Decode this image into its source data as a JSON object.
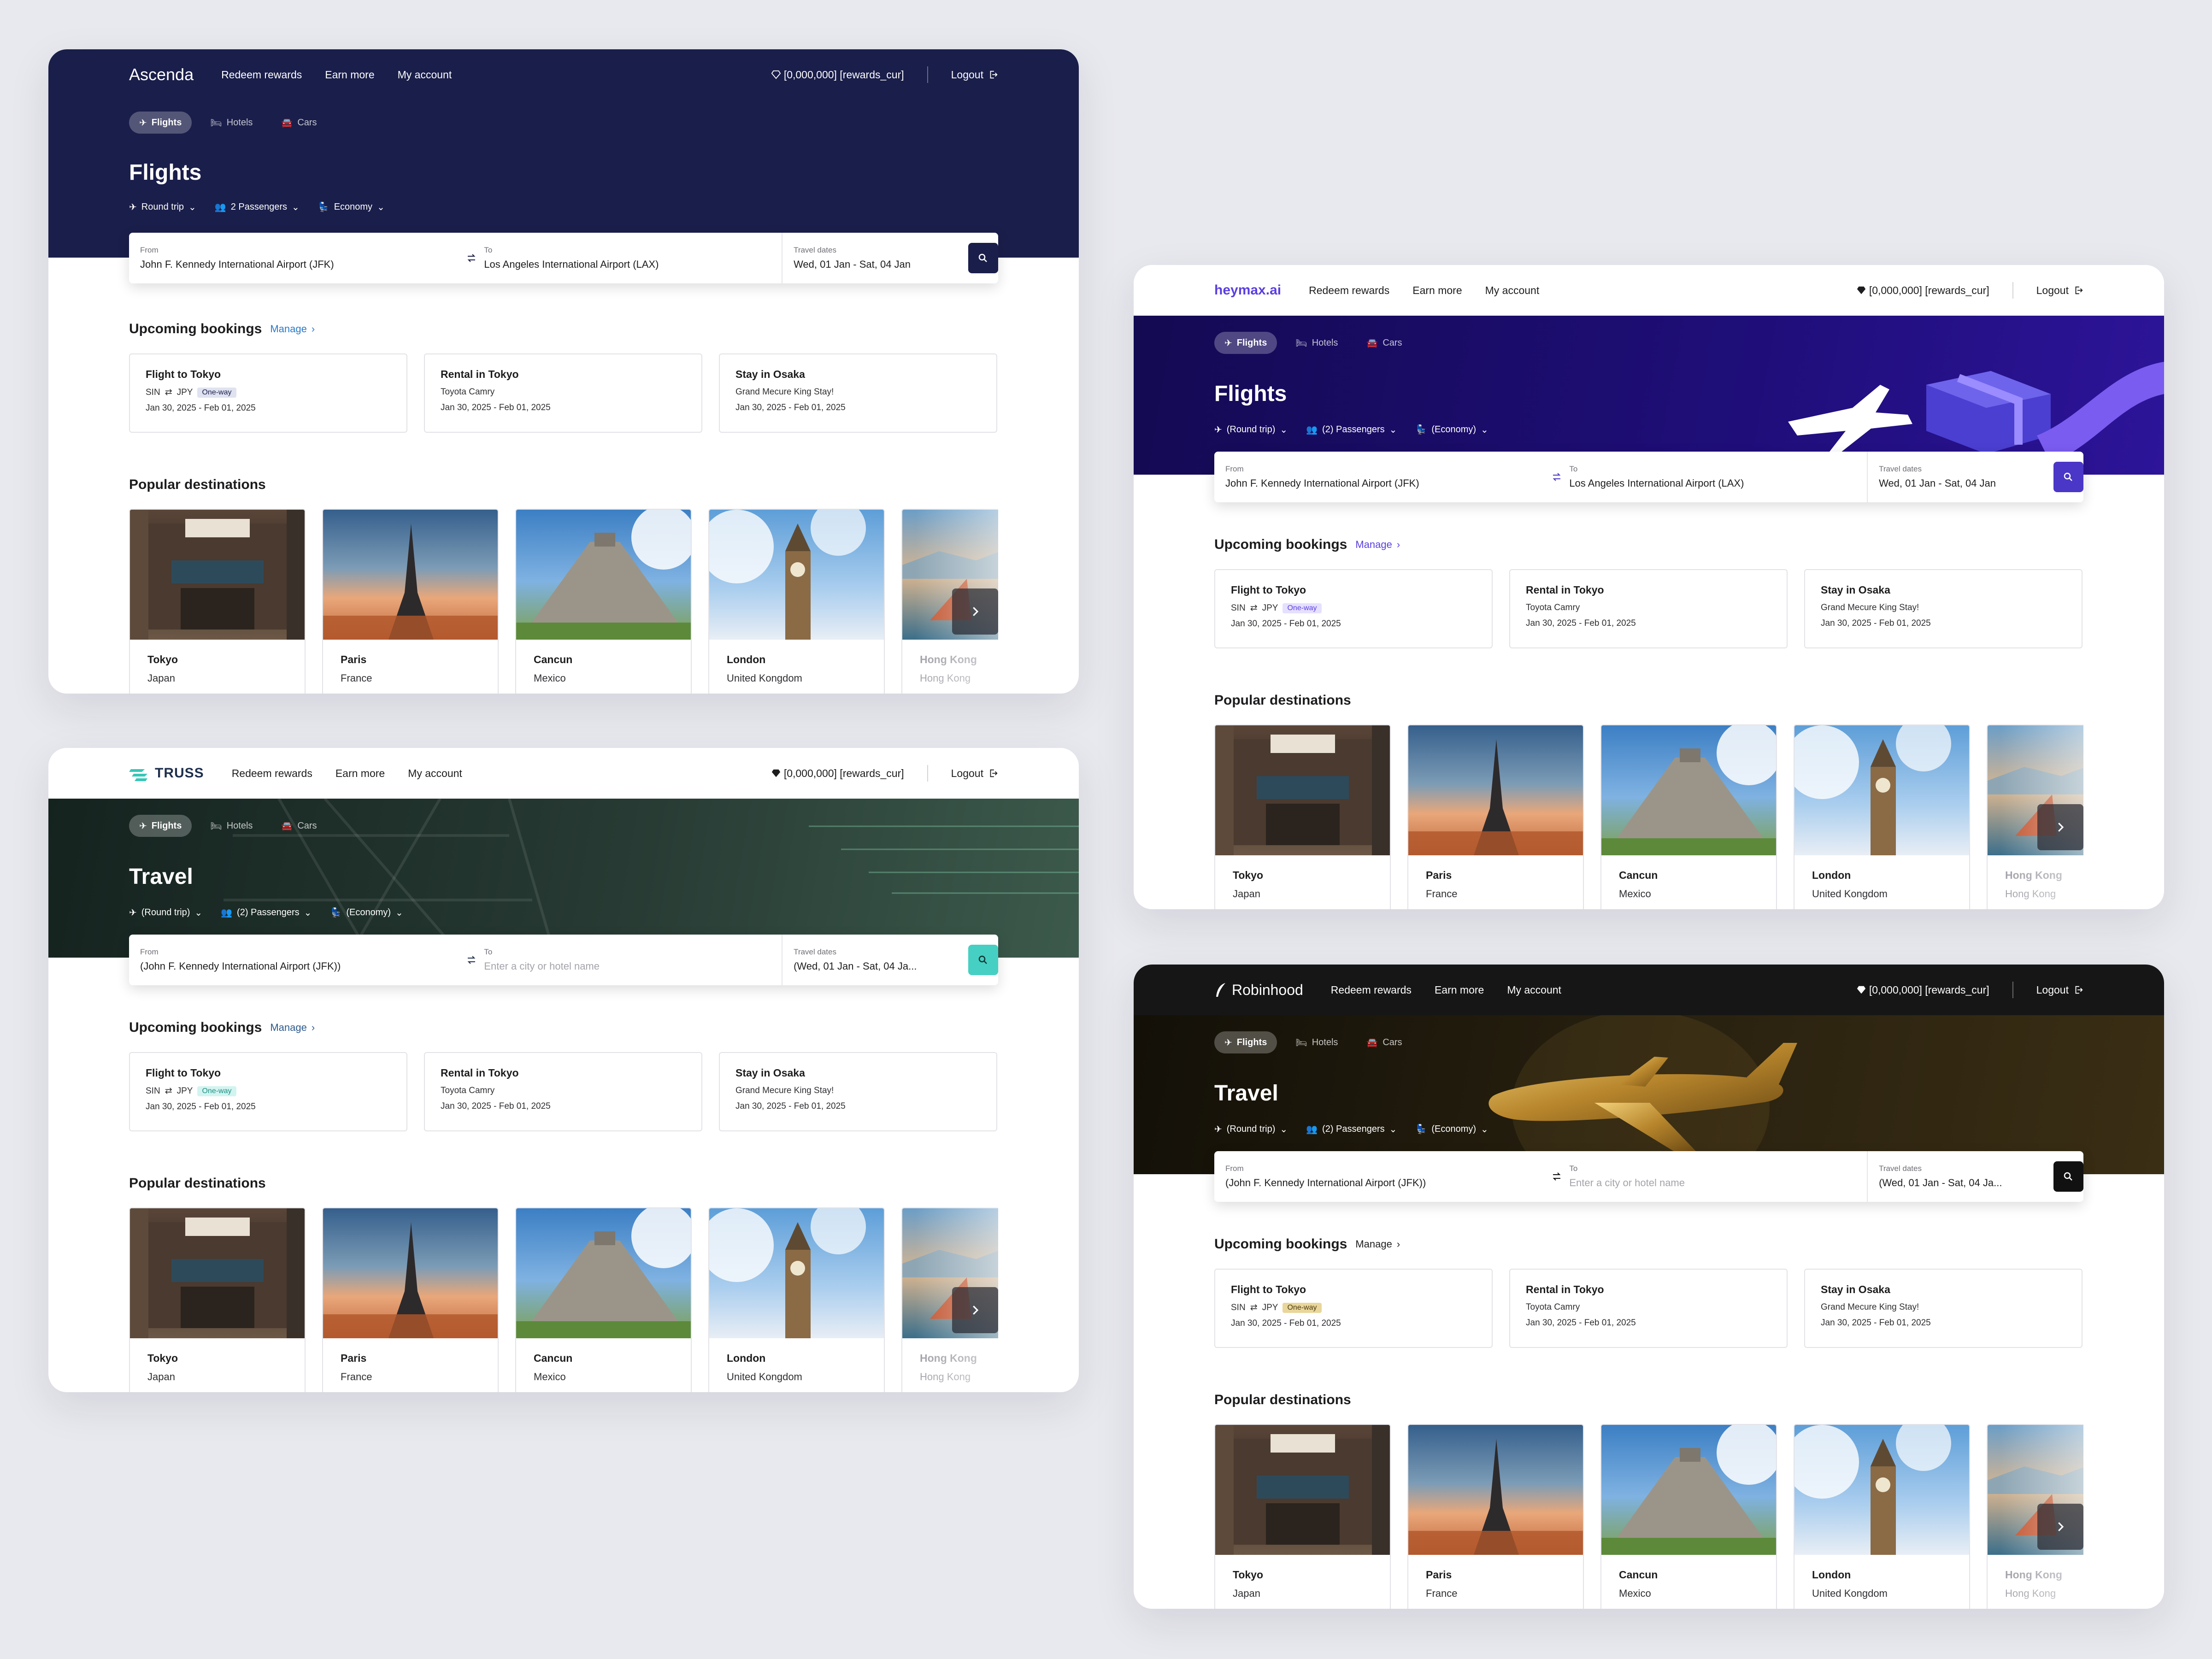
{
  "common": {
    "nav": {
      "redeem": "Redeem rewards",
      "earn": "Earn more",
      "account": "My account",
      "rewards": "[0,000,000] [rewards_cur]",
      "logout": "Logout"
    },
    "tabs": {
      "flights": "Flights",
      "hotels": "Hotels",
      "cars": "Cars"
    },
    "search": {
      "from_label": "From",
      "to_label": "To",
      "dates_label": "Travel dates",
      "from_value": "John F. Kennedy International Airport (JFK)",
      "to_value": "Los Angeles International Airport (LAX)",
      "to_placeholder": "Enter a city or hotel name",
      "dates_value": "Wed, 01 Jan - Sat, 04 Jan",
      "from_value_paren": "(John F. Kennedy International Airport (JFK))",
      "dates_value_paren": "(Wed, 01 Jan - Sat, 04 Ja..."
    },
    "options": {
      "round_trip": "Round trip",
      "passengers": "2 Passengers",
      "economy": "Economy",
      "round_trip_paren": "(Round trip)",
      "passengers_paren": "(2) Passengers",
      "economy_paren": "(Economy)"
    },
    "upcoming_title": "Upcoming bookings",
    "manage": "Manage",
    "bookings": {
      "flight": {
        "title": "Flight to Tokyo",
        "from": "SIN",
        "to": "JPY",
        "badge": "One-way",
        "dates": "Jan 30, 2025 - Feb 01, 2025"
      },
      "rental": {
        "title": "Rental in Tokyo",
        "car": "Toyota Camry",
        "dates": "Jan 30, 2025 - Feb 01, 2025"
      },
      "stay": {
        "title": "Stay in Osaka",
        "hotel": "Grand Mecure King Stay!",
        "dates": "Jan 30, 2025 - Feb 01, 2025"
      }
    },
    "popular_title": "Popular destinations",
    "destinations": [
      {
        "city": "Tokyo",
        "country": "Japan"
      },
      {
        "city": "Paris",
        "country": "France"
      },
      {
        "city": "Cancun",
        "country": "Mexico"
      },
      {
        "city": "London",
        "country": "United Kongdom"
      },
      {
        "city": "Hong Kong",
        "country": "Hong Kong"
      }
    ]
  },
  "brands": {
    "ascenda": {
      "logo": "Ascenda",
      "hero_title": "Flights",
      "accent": "#1a1e4a",
      "manage_color": "#2a79c9"
    },
    "truss": {
      "logo": "TRUSS",
      "hero_title": "Travel",
      "accent": "#45d0c3",
      "manage_color": "#2d5a8c"
    },
    "heymax": {
      "logo": "heymax.ai",
      "hero_title": "Flights",
      "accent": "#4a36c7",
      "manage_color": "#5b3fe0"
    },
    "robinhood": {
      "logo": "Robinhood",
      "hero_title": "Travel",
      "accent": "#111111",
      "manage_color": "#222222"
    }
  }
}
